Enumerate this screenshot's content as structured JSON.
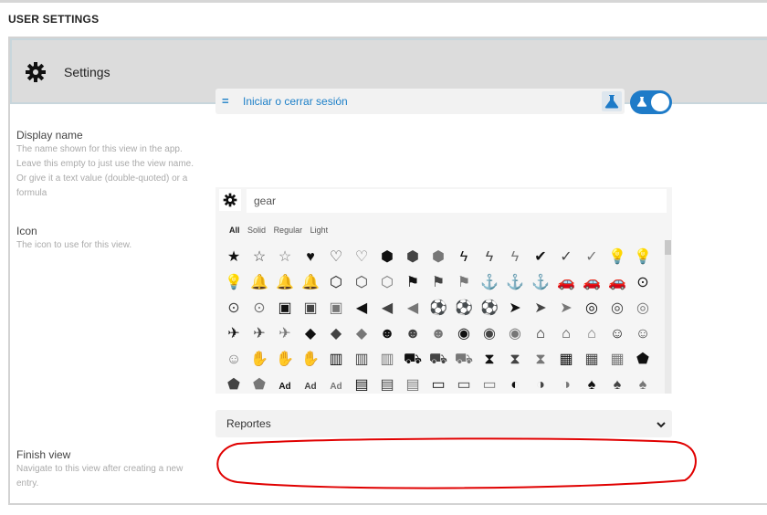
{
  "page": {
    "title": "USER SETTINGS"
  },
  "panel": {
    "title": "Settings",
    "icon": "gear-icon"
  },
  "display_name": {
    "label": "Display name",
    "description": "The name shown for this view in the app. Leave this empty to just use the view name. Or give it a text value (double-quoted) or a formula",
    "formula_prefix": "=",
    "value": "Iniciar o cerrar sesión",
    "toggle_on": true
  },
  "icon_field": {
    "label": "Icon",
    "description": "The icon to use for this view.",
    "search_value": "gear",
    "filters": [
      "All",
      "Solid",
      "Regular",
      "Light"
    ],
    "active_filter": "All",
    "icons": [
      [
        "star-solid",
        "star-regular",
        "star-light",
        "heart-solid",
        "heart-regular",
        "heart-light",
        "cube-solid",
        "cube-regular",
        "cube-light",
        "bolt-solid",
        "bolt-regular",
        "bolt-light",
        "check-circle-solid",
        "check-circle-regular",
        "check-circle-light",
        "lightbulb-solid",
        "lightbulb-regular"
      ],
      [
        "lightbulb-light",
        "bell-solid",
        "bell-regular",
        "bell-light",
        "cubes-solid",
        "cubes-regular",
        "cubes-light",
        "flag-solid",
        "flag-regular",
        "flag-light",
        "anchor-solid",
        "anchor-regular",
        "anchor-light",
        "car-solid",
        "car-regular",
        "car-light",
        "binoculars-solid"
      ],
      [
        "binoculars-regular",
        "binoculars-light",
        "briefcase-solid",
        "briefcase-regular",
        "briefcase-light",
        "bullhorn-solid",
        "bullhorn-regular",
        "bullhorn-light",
        "futbol-solid",
        "futbol-regular",
        "futbol-light",
        "paper-plane-solid",
        "paper-plane-regular",
        "paper-plane-light",
        "life-ring-solid",
        "life-ring-regular",
        "life-ring-light"
      ],
      [
        "plane-solid",
        "plane-regular",
        "plane-light",
        "tags-solid",
        "tags-regular",
        "tags-light",
        "users-solid",
        "users-regular",
        "users-light",
        "eye-solid",
        "eye-regular",
        "eye-light",
        "university-solid",
        "university-regular",
        "university-light",
        "smile-solid",
        "smile-regular"
      ],
      [
        "smile-light",
        "thumbs-up-solid",
        "thumbs-up-regular",
        "thumbs-up-light",
        "suitcase-solid",
        "suitcase-regular",
        "suitcase-light",
        "truck-solid",
        "truck-regular",
        "truck-light",
        "hourglass-solid",
        "hourglass-regular",
        "hourglass-light",
        "abacus-solid",
        "abacus-regular",
        "abacus-light",
        "acorn-solid"
      ],
      [
        "acorn-regular",
        "acorn-light",
        "ad-solid",
        "ad-regular",
        "ad-light",
        "address-book-solid",
        "address-book-regular",
        "address-book-light",
        "address-card-solid",
        "address-card-regular",
        "address-card-light",
        "adjust-solid",
        "adjust-regular",
        "adjust-light",
        "tree-solid",
        "tree-regular",
        "tree-light"
      ]
    ]
  },
  "finish_view": {
    "label": "Finish view",
    "description": "Navigate to this view after creating a new entry.",
    "selected": "Reportes"
  },
  "colors": {
    "accent": "#1e7bc8",
    "annotation": "#e00000",
    "header_bg": "#dcdcdc"
  }
}
